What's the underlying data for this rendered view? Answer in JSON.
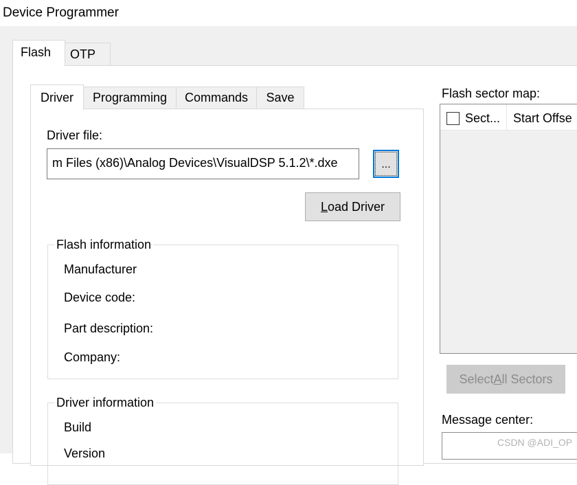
{
  "window": {
    "title": "Device Programmer"
  },
  "outer_tabs": [
    {
      "label": "Flash",
      "active": true
    },
    {
      "label": "OTP",
      "active": false
    }
  ],
  "inner_tabs": [
    {
      "label": "Driver",
      "active": true
    },
    {
      "label": "Programming",
      "active": false
    },
    {
      "label": "Commands",
      "active": false
    },
    {
      "label": "Save",
      "active": false
    }
  ],
  "driver": {
    "file_label": "Driver file:",
    "file_value": "m Files (x86)\\Analog Devices\\VisualDSP 5.1.2\\*.dxe",
    "browse_label": "...",
    "load_button": {
      "mnemonic": "L",
      "rest": "oad Driver"
    }
  },
  "flash_info": {
    "title": "Flash information",
    "fields": [
      "Manufacturer",
      "Device code:",
      "Part description:",
      "Company:"
    ]
  },
  "driver_info": {
    "title": "Driver information",
    "fields": [
      "Build",
      "Version"
    ]
  },
  "sector_map": {
    "label": "Flash sector map:",
    "columns": [
      "Sect...",
      "Start Offse"
    ],
    "select_all": {
      "prefix": "Select ",
      "mnemonic": "A",
      "rest": "ll Sectors"
    }
  },
  "message_center": {
    "label": "Message center:"
  },
  "watermark": "CSDN @ADI_OP"
}
